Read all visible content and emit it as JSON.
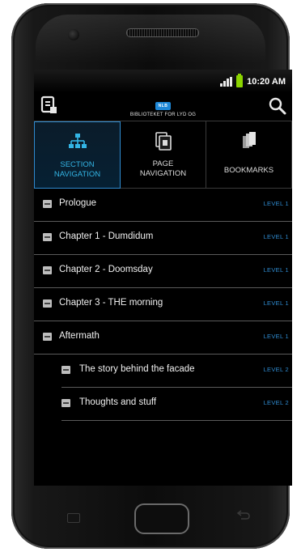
{
  "status": {
    "time": "10:20 AM"
  },
  "appbar": {
    "logo": "NLB",
    "brand_text": "BIBLIOTEKET FOR LYD OG"
  },
  "tabs": [
    {
      "label_line1": "SECTION",
      "label_line2": "NAVIGATION",
      "icon": "sitemap-icon",
      "active": true
    },
    {
      "label_line1": "PAGE",
      "label_line2": "NAVIGATION",
      "icon": "page-icon",
      "active": false
    },
    {
      "label": "BOOKMARKS",
      "icon": "bookmarks-icon",
      "active": false
    }
  ],
  "sections": [
    {
      "title": "Prologue",
      "level": "LEVEL 1"
    },
    {
      "title": "Chapter 1 - Dumdidum",
      "level": "LEVEL 1"
    },
    {
      "title": "Chapter 2 - Doomsday",
      "level": "LEVEL 1"
    },
    {
      "title": "Chapter 3 - THE morning",
      "level": "LEVEL 1"
    },
    {
      "title": "Aftermath",
      "level": "LEVEL 1"
    },
    {
      "title": "The story behind the facade",
      "level": "LEVEL 2"
    },
    {
      "title": "Thoughts and stuff",
      "level": "LEVEL 2"
    }
  ],
  "colors": {
    "accent": "#33b5e5",
    "level_text": "#2f8bd0",
    "battery": "#8bd400"
  }
}
